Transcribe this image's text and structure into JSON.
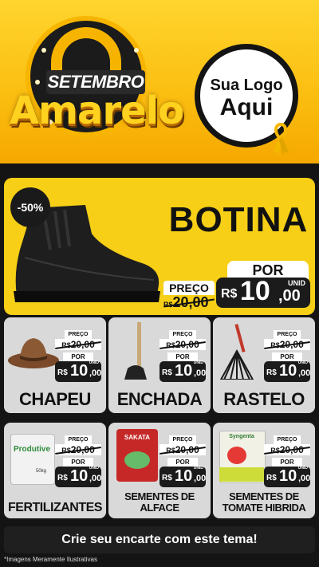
{
  "header": {
    "campaign_top": "SETEMBRO",
    "campaign_main": "Amarelo",
    "logo_line1": "Sua Logo",
    "logo_line2": "Aqui",
    "accent": "#fbbf12",
    "dark": "#141414"
  },
  "hero": {
    "discount": "-50%",
    "title": "BOTINA",
    "preco_label": "PREÇO",
    "old_currency": "R$",
    "old_price": "20,00",
    "por_label": "POR",
    "unid": "UNID",
    "new_currency": "R$",
    "new_int": "10",
    "new_dec": ",00",
    "icon": "boot-icon"
  },
  "products": [
    {
      "name": "CHAPEU",
      "icon": "hat-icon",
      "preco": "PREÇO",
      "old_cur": "R$",
      "old": "20,00",
      "por": "POR",
      "cur": "R$",
      "int": "10",
      "dec": ",00",
      "unid": "UNID"
    },
    {
      "name": "ENCHADA",
      "icon": "hoe-icon",
      "preco": "PREÇO",
      "old_cur": "R$",
      "old": "20,00",
      "por": "POR",
      "cur": "R$",
      "int": "10",
      "dec": ",00",
      "unid": "UNID"
    },
    {
      "name": "RASTELO",
      "icon": "rake-icon",
      "preco": "PREÇO",
      "old_cur": "R$",
      "old": "20,00",
      "por": "POR",
      "cur": "R$",
      "int": "10",
      "dec": ",00",
      "unid": "UNID"
    },
    {
      "name": "FERTILIZANTES",
      "icon": "fertilizer-bag-icon",
      "pic_text": "Produtive",
      "pic_sub": "50kg",
      "preco": "PREÇO",
      "old_cur": "R$",
      "old": "20,00",
      "por": "POR",
      "cur": "R$",
      "int": "10",
      "dec": ",00",
      "unid": "UNID"
    },
    {
      "name": "SEMENTES DE",
      "name2": "ALFACE",
      "icon": "seed-packet-icon",
      "pic_text": "SAKATA",
      "preco": "PREÇO",
      "old_cur": "R$",
      "old": "20,00",
      "por": "POR",
      "cur": "R$",
      "int": "10",
      "dec": ",00",
      "unid": "UNID"
    },
    {
      "name": "SEMENTES DE",
      "name2": "TOMATE HIBRIDA",
      "icon": "seed-packet-icon",
      "pic_text": "Syngenta",
      "preco": "PREÇO",
      "old_cur": "R$",
      "old": "20,00",
      "por": "POR",
      "cur": "R$",
      "int": "10",
      "dec": ",00",
      "unid": "UNID"
    }
  ],
  "cta": "Crie seu encarte com este tema!",
  "footnote": "*Imagens Meramente Ilustrativas"
}
